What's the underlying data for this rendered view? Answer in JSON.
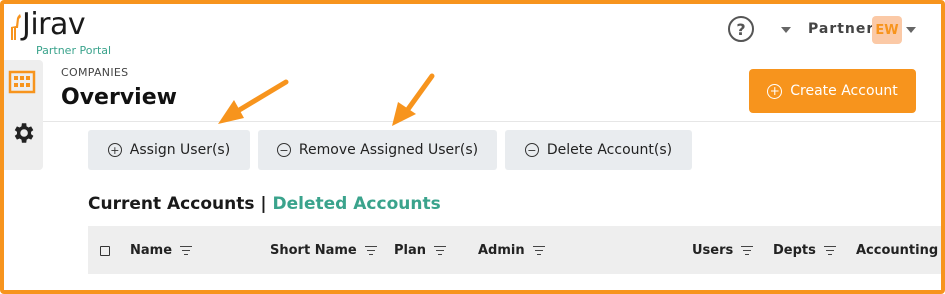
{
  "app": {
    "logo_text": "Jirav",
    "portal_label": "Partner Portal"
  },
  "header": {
    "help_icon": "question-circle-icon",
    "partner_label": "Partner",
    "avatar_initials": "EW"
  },
  "sidebar": {
    "items": [
      {
        "icon": "building-icon"
      },
      {
        "icon": "gear-icon"
      }
    ]
  },
  "page": {
    "breadcrumb": "COMPANIES",
    "title": "Overview",
    "create_button": "Create Account"
  },
  "actions": {
    "assign": "Assign User(s)",
    "remove": "Remove Assigned User(s)",
    "delete": "Delete Account(s)"
  },
  "accounts": {
    "current": "Current Accounts",
    "separator": "|",
    "deleted": "Deleted Accounts"
  },
  "table": {
    "columns": [
      "Name",
      "Short Name",
      "Plan",
      "Admin",
      "Users",
      "Depts",
      "Accounting"
    ]
  },
  "colors": {
    "accent": "#f7941d",
    "teal": "#3aa38c",
    "avatar_bg": "#fbc9a6"
  }
}
